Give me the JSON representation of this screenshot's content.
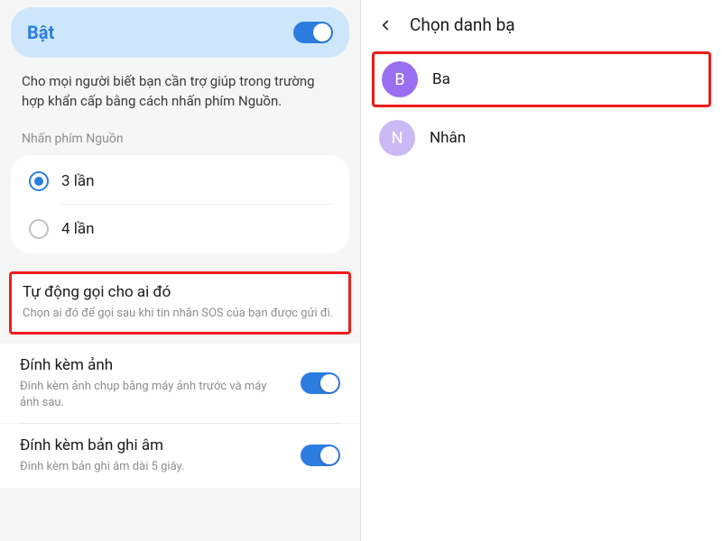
{
  "left": {
    "header": {
      "title": "Bật",
      "toggle_on": true
    },
    "description": "Cho mọi người biết bạn cần trợ giúp trong trường hợp khẩn cấp bằng cách nhấn phím Nguồn.",
    "section_label": "Nhấn phím Nguồn",
    "radios": [
      {
        "label": "3 lần",
        "selected": true
      },
      {
        "label": "4 lần",
        "selected": false
      }
    ],
    "auto_call": {
      "title": "Tự động gọi cho ai đó",
      "subtitle": "Chọn ai đó để gọi sau khi tin nhắn SOS của bạn được gửi đi."
    },
    "attach_photo": {
      "title": "Đính kèm ảnh",
      "subtitle": "Đính kèm ảnh chụp bằng máy ảnh trước và máy ảnh sau.",
      "toggle_on": true
    },
    "attach_audio": {
      "title": "Đính kèm bản ghi âm",
      "subtitle": "Đính kèm bản ghi âm dài 5 giây.",
      "toggle_on": true
    }
  },
  "right": {
    "title": "Chọn danh bạ",
    "contacts": [
      {
        "initial": "B",
        "name": "Ba",
        "avatar_color": "purple",
        "highlighted": true
      },
      {
        "initial": "N",
        "name": "Nhân",
        "avatar_color": "lavender",
        "highlighted": false
      }
    ]
  }
}
